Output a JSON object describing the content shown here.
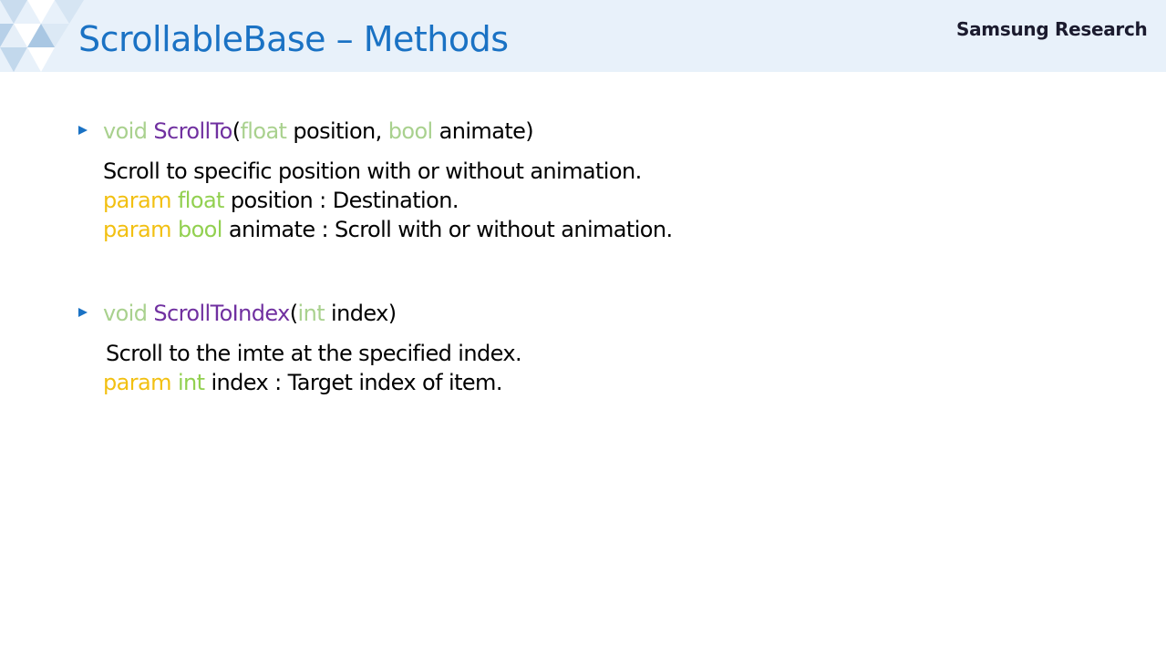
{
  "header": {
    "title": "ScrollableBase – Methods",
    "brand": "Samsung Research"
  },
  "methods": [
    {
      "signature": {
        "ret": "void",
        "name": "ScrollTo",
        "open": "(",
        "t1": "float",
        "p1": "position,",
        "t2": "bool",
        "p2": "animate)"
      },
      "summary": "Scroll to specific position with or without animation.",
      "params": [
        {
          "keyword": "param",
          "type": "float",
          "name": "position",
          "desc": " : Destination."
        },
        {
          "keyword": "param",
          "type": "bool",
          "name": "animate",
          "desc": " :  Scroll with or without animation."
        }
      ]
    },
    {
      "signature": {
        "ret": "void",
        "name": "ScrollToIndex",
        "open": "(",
        "t1": "int",
        "p1": "index)"
      },
      "summary": "Scroll to the imte at the specified index.",
      "params": [
        {
          "keyword": "param",
          "type": "int",
          "name": "index",
          "desc": " : Target index of item."
        }
      ]
    }
  ],
  "colors": {
    "title": "#1a72c4",
    "keyword_type": "#a9d18e",
    "method_name": "#7030a0",
    "param_keyword": "#f2c012",
    "param_type": "#92d050",
    "bullet": "#1a72c4",
    "header_bg": "#e8f1fa"
  },
  "icons": {
    "bullet": "triangle-bullet-icon",
    "decoration": "triangle-pattern-icon"
  }
}
